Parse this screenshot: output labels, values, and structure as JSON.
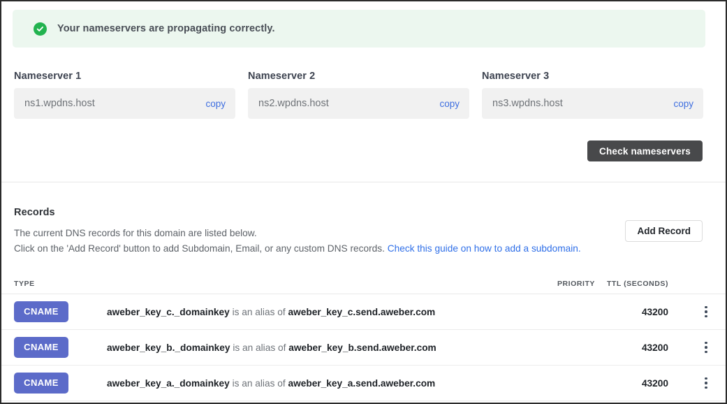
{
  "banner": {
    "icon": "check-circle-icon",
    "message": "Your nameservers are propagating correctly.",
    "background_color": "#ecf7ef",
    "icon_color": "#22b34f"
  },
  "nameservers": {
    "items": [
      {
        "label": "Nameserver 1",
        "value": "ns1.wpdns.host",
        "copy_label": "copy"
      },
      {
        "label": "Nameserver 2",
        "value": "ns2.wpdns.host",
        "copy_label": "copy"
      },
      {
        "label": "Nameserver 3",
        "value": "ns3.wpdns.host",
        "copy_label": "copy"
      }
    ],
    "check_button_label": "Check nameservers",
    "check_button_color": "#48494b"
  },
  "records": {
    "title": "Records",
    "description_line1": "The current DNS records for this domain are listed below.",
    "description_line2_prefix": "Click on the 'Add Record' button to add Subdomain, Email, or any custom DNS records. ",
    "guide_link_text": "Check this guide on how to add a subdomain.",
    "guide_link_color": "#2f6fe8",
    "add_record_label": "Add Record",
    "columns": {
      "type": "TYPE",
      "description": "",
      "priority": "PRIORITY",
      "ttl": "TTL (SECONDS)"
    },
    "badge_color": "#5c6bc9",
    "rows": [
      {
        "type": "CNAME",
        "host": "aweber_key_c._domainkey",
        "relation": " is an alias of ",
        "target": "aweber_key_c.send.aweber.com",
        "priority": "",
        "ttl": "43200",
        "menu_icon": "kebab-menu-icon"
      },
      {
        "type": "CNAME",
        "host": "aweber_key_b._domainkey",
        "relation": " is an alias of ",
        "target": "aweber_key_b.send.aweber.com",
        "priority": "",
        "ttl": "43200",
        "menu_icon": "kebab-menu-icon"
      },
      {
        "type": "CNAME",
        "host": "aweber_key_a._domainkey",
        "relation": " is an alias of ",
        "target": "aweber_key_a.send.aweber.com",
        "priority": "",
        "ttl": "43200",
        "menu_icon": "kebab-menu-icon"
      }
    ]
  }
}
